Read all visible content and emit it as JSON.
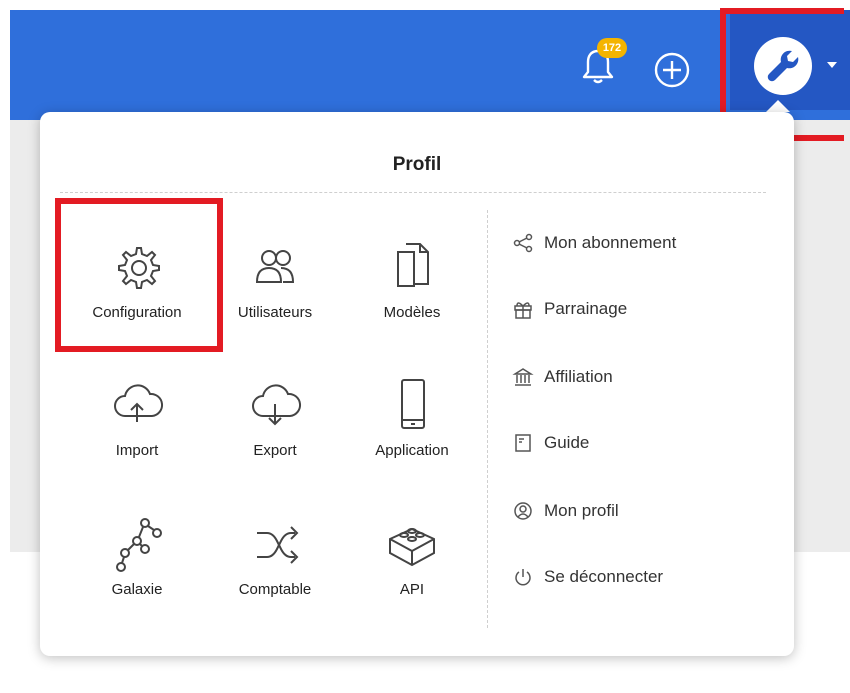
{
  "header": {
    "notification_count": "172",
    "accent_color": "#2f6fdb",
    "bell_icon": "bell-icon",
    "plus_icon": "plus-circle-icon",
    "wrench_icon": "wrench-icon"
  },
  "menu": {
    "title": "Profil",
    "tiles": [
      {
        "label": "Configuration",
        "icon": "gear-icon"
      },
      {
        "label": "Utilisateurs",
        "icon": "users-icon"
      },
      {
        "label": "Modèles",
        "icon": "documents-icon"
      },
      {
        "label": "Import",
        "icon": "cloud-upload-icon"
      },
      {
        "label": "Export",
        "icon": "cloud-download-icon"
      },
      {
        "label": "Application",
        "icon": "mobile-icon"
      },
      {
        "label": "Galaxie",
        "icon": "graph-nodes-icon"
      },
      {
        "label": "Comptable",
        "icon": "shuffle-icon"
      },
      {
        "label": "API",
        "icon": "lego-brick-icon"
      }
    ],
    "links": [
      {
        "label": "Mon abonnement",
        "icon": "share-icon"
      },
      {
        "label": "Parrainage",
        "icon": "gift-icon"
      },
      {
        "label": "Affiliation",
        "icon": "bank-icon"
      },
      {
        "label": "Guide",
        "icon": "book-icon"
      },
      {
        "label": "Mon profil",
        "icon": "user-badge-icon"
      },
      {
        "label": "Se déconnecter",
        "icon": "power-icon"
      }
    ]
  },
  "highlight_color": "#e31b23"
}
